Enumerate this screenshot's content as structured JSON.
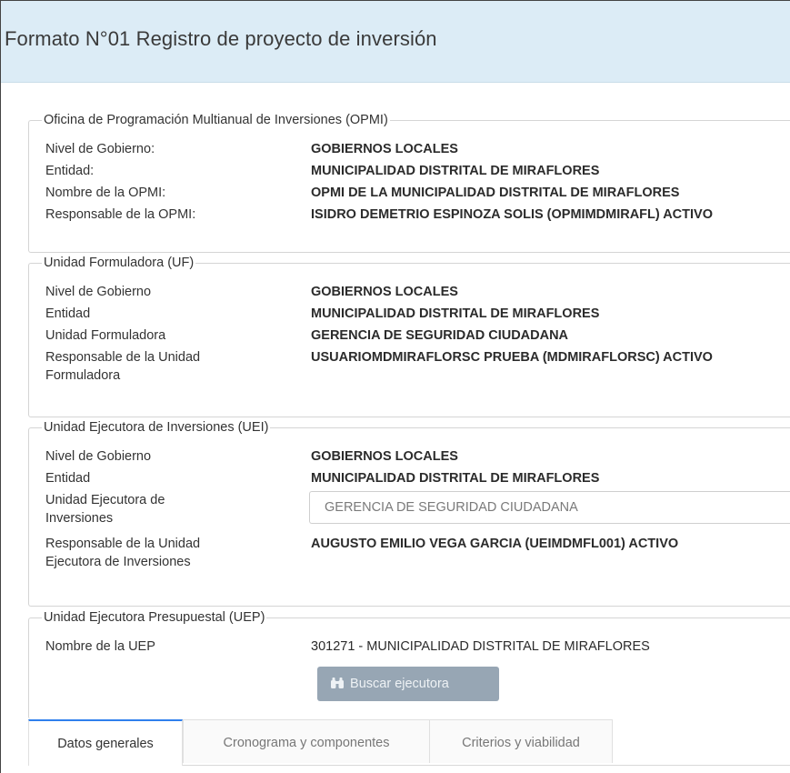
{
  "page": {
    "title": "Formato N°01 Registro de proyecto de inversión"
  },
  "opmi": {
    "legend": "Oficina de Programación Multianual de Inversiones (OPMI)",
    "rows": [
      {
        "label": "Nivel de Gobierno:",
        "value": "GOBIERNOS LOCALES"
      },
      {
        "label": "Entidad:",
        "value": "MUNICIPALIDAD DISTRITAL DE MIRAFLORES"
      },
      {
        "label": "Nombre de la OPMI:",
        "value": "OPMI DE LA MUNICIPALIDAD DISTRITAL DE MIRAFLORES"
      },
      {
        "label": "Responsable de la OPMI:",
        "value": "ISIDRO DEMETRIO ESPINOZA SOLIS (OPMIMDMIRAFL) ACTIVO"
      }
    ]
  },
  "uf": {
    "legend": "Unidad Formuladora (UF)",
    "rows": [
      {
        "label": "Nivel de Gobierno",
        "value": "GOBIERNOS LOCALES"
      },
      {
        "label": "Entidad",
        "value": "MUNICIPALIDAD DISTRITAL DE MIRAFLORES"
      },
      {
        "label": "Unidad Formuladora",
        "value": "GERENCIA DE SEGURIDAD CIUDADANA"
      },
      {
        "label_line1": "Responsable de la Unidad",
        "label_line2": "Formuladora",
        "value": "USUARIOMDMIRAFLORSC PRUEBA (MDMIRAFLORSC) ACTIVO"
      }
    ]
  },
  "uei": {
    "legend": "Unidad Ejecutora de Inversiones (UEI)",
    "rows": [
      {
        "label": "Nivel de Gobierno",
        "value": "GOBIERNOS LOCALES"
      },
      {
        "label": "Entidad",
        "value": "MUNICIPALIDAD DISTRITAL DE MIRAFLORES"
      },
      {
        "label_line1": "Unidad Ejecutora de",
        "label_line2": "Inversiones",
        "select_value": "GERENCIA DE SEGURIDAD CIUDADANA"
      },
      {
        "label_line1": "Responsable de la Unidad",
        "label_line2": "Ejecutora de Inversiones",
        "value": "AUGUSTO EMILIO VEGA GARCIA (UEIMDMFL001) ACTIVO"
      }
    ]
  },
  "uep": {
    "legend": "Unidad Ejecutora Presupuestal (UEP)",
    "label": "Nombre de la UEP",
    "value": "301271 - MUNICIPALIDAD DISTRITAL DE MIRAFLORES",
    "button_label": "Buscar ejecutora",
    "button_icon": "binoculars-icon"
  },
  "tabs": [
    {
      "label": "Datos generales",
      "active": true
    },
    {
      "label": "Cronograma y componentes",
      "active": false
    },
    {
      "label": "Criterios y viabilidad",
      "active": false
    }
  ],
  "colors": {
    "header_bg": "#dcecf6",
    "button_bg": "#97a6b4",
    "tab_active_border": "#2f80ed"
  }
}
